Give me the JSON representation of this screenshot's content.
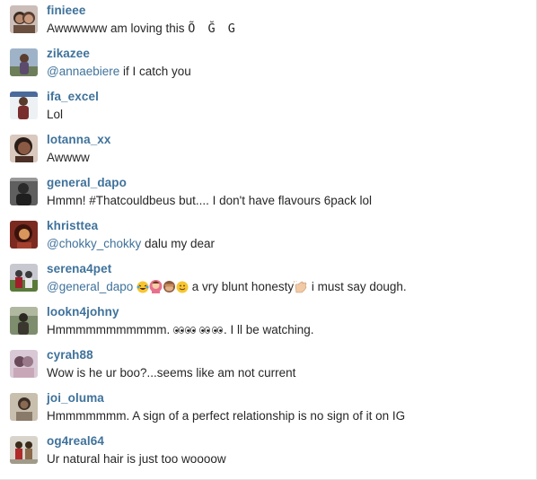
{
  "comments": [
    {
      "username": "finieee",
      "pre": "Awwwwww am loving this ",
      "glyphs": "Õ Ğ G",
      "avatar": {
        "bg": "#cbbdb8",
        "fg": "#6a4e3e",
        "top": "#3a2a24"
      }
    },
    {
      "username": "zikazee",
      "mention": "@annaebiere",
      "post": " if I catch you",
      "avatar": {
        "bg": "#9fb3c8",
        "fg": "#5b4a6b",
        "top": "#2c2f47"
      }
    },
    {
      "username": "ifa_excel",
      "text": "Lol",
      "avatar": {
        "bg": "#eef1f4",
        "fg": "#7a2d2d",
        "top": "#4a6a9a"
      }
    },
    {
      "username": "lotanna_xx",
      "text": "Awwww",
      "avatar": {
        "bg": "#d9c9bf",
        "fg": "#4a3026",
        "top": "#2a1c16"
      }
    },
    {
      "username": "general_dapo",
      "text": "Hmmn! #Thatcouldbeus but.... I don't have flavours 6pack lol",
      "avatar": {
        "bg": "#5f5f5f",
        "fg": "#1f1f1f",
        "top": "#9a9a9a"
      }
    },
    {
      "username": "khristtea",
      "mention": "@chokky_chokky",
      "post": " dalu my dear",
      "avatar": {
        "bg": "#7b2a20",
        "fg": "#d8965c",
        "top": "#3a120c"
      }
    },
    {
      "username": "serena4pet",
      "mention": "@general_dapo",
      "post_a": " a vry blunt honesty",
      "post_b": " i must say dough.",
      "avatar": {
        "bg": "#c8c8d0",
        "fg": "#a11f2a",
        "top": "#3a3a3a"
      }
    },
    {
      "username": "lookn4johny",
      "pre": "Hmmmmmmmmmmm. ",
      "post": ". I ll be watching.",
      "avatar": {
        "bg": "#7e8d6e",
        "fg": "#2c2a22",
        "top": "#b0b8a0"
      }
    },
    {
      "username": "cyrah88",
      "text": "Wow is he ur boo?...seems like am not current",
      "avatar": {
        "bg": "#d9c9d6",
        "fg": "#6a4a5a",
        "top": "#9a7a8a"
      }
    },
    {
      "username": "joi_oluma",
      "text": "Hmmmmmmm. A sign of a perfect relationship is no sign of it on IG",
      "avatar": {
        "bg": "#c9bfae",
        "fg": "#3a2e26",
        "top": "#8a7a6a"
      }
    },
    {
      "username": "og4real64",
      "text": "Ur natural hair is just too woooow",
      "avatar": {
        "bg": "#d8d4cc",
        "fg": "#b02a2a",
        "top": "#8a6a4a"
      }
    }
  ],
  "colors": {
    "username": "#3f729b",
    "text": "#262626",
    "mention": "#3f729b"
  }
}
